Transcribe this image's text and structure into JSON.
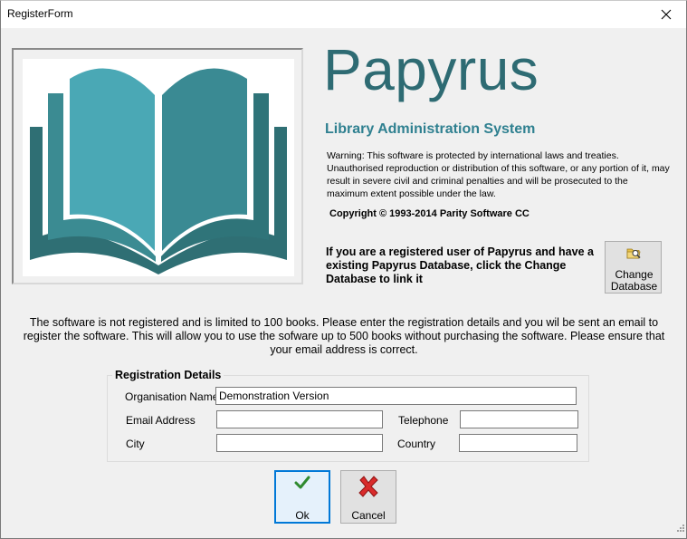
{
  "window": {
    "title": "RegisterForm"
  },
  "header": {
    "app_name": "Papyrus",
    "subtitle": "Library Administration System",
    "warning": "Warning:  This software is protected by international laws and treaties. Unauthorised reproduction or distribution of this software, or any portion of it, may result in severe civil and criminal penalties and will be prosecuted to the maximum extent possible under the law.",
    "copyright": "Copyright © 1993-2014  Parity Software CC"
  },
  "registered_note": "If you are a registered user of Papyrus and have a existing Papyrus Database, click the Change Database to link it",
  "change_database": {
    "label": "Change Database",
    "icon": "folder-search-icon"
  },
  "info": "The software is not registered and is limited to 100 books.  Please enter the registration details  and you wil be sent an email to register the software.  This will allow you to use the sofware up to 500 books without purchasing the software.  Please ensure that your email address is correct.",
  "registration": {
    "title": "Registration Details",
    "organisation": {
      "label": "Organisation Name",
      "value": "Demonstration Version"
    },
    "email": {
      "label": "Email Address",
      "value": ""
    },
    "telephone": {
      "label": "Telephone",
      "value": ""
    },
    "city": {
      "label": "City",
      "value": ""
    },
    "country": {
      "label": "Country",
      "value": ""
    }
  },
  "buttons": {
    "ok": {
      "label": "Ok",
      "icon": "checkmark-icon"
    },
    "cancel": {
      "label": "Cancel",
      "icon": "red-x-icon"
    }
  },
  "colors": {
    "brand": "#2e6b73",
    "subtitle": "#2f8090",
    "book_light": "#4aa8b5",
    "book_dark": "#2f6f74"
  }
}
